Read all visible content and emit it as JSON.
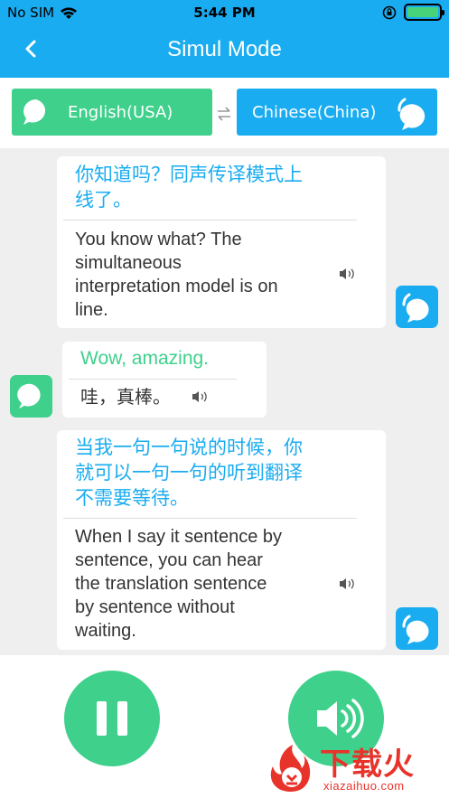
{
  "status": {
    "carrier": "No SIM",
    "time": "5:44 PM"
  },
  "nav": {
    "title": "Simul Mode"
  },
  "languages": {
    "left": "English(USA)",
    "right": "Chinese(China)"
  },
  "messages": [
    {
      "speaker": "chinese",
      "source": [
        "你知道吗？同声传译模式上",
        "线了。"
      ],
      "translation": [
        "You know what? The",
        "simultaneous",
        "interpretation model is on",
        "line."
      ]
    },
    {
      "speaker": "english",
      "source": [
        "Wow, amazing."
      ],
      "translation": [
        "哇，真棒。"
      ]
    },
    {
      "speaker": "chinese",
      "source": [
        "当我一句一句说的时候，你",
        "就可以一句一句的听到翻译",
        "不需要等待。"
      ],
      "translation": [
        "When I say it sentence by",
        "sentence, you can hear",
        "the translation sentence",
        "by sentence without",
        "waiting."
      ]
    }
  ],
  "watermark": {
    "text_cn": "下载火",
    "text_en": "xiazaihuo.com"
  },
  "colors": {
    "blue": "#1aacf0",
    "green": "#3fd08c",
    "source_blue": "#1aacf0",
    "source_green": "#3fd08c"
  },
  "icons": {
    "back": "chevron-left-icon",
    "chat": "chat-bubble-icon",
    "swap": "swap-arrows-icon",
    "speaker": "speaker-icon",
    "pause": "pause-icon"
  }
}
